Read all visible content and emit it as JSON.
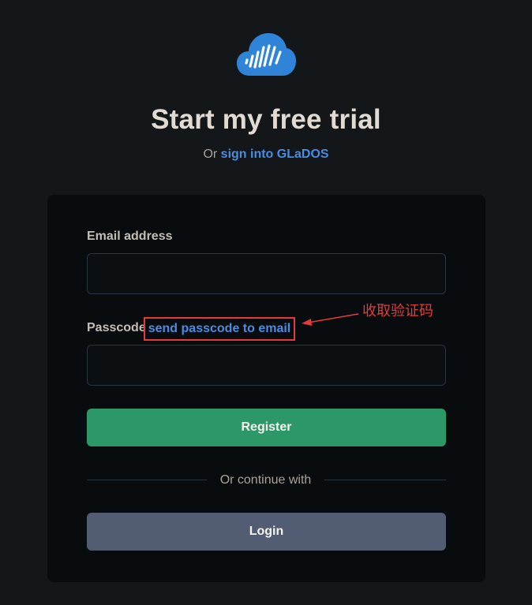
{
  "brand": {
    "logo_icon": "cloud-waveform-icon",
    "logo_color": "#2f84d8"
  },
  "header": {
    "title": "Start my free trial",
    "subtitle_prefix": "Or",
    "signin_link": "sign into GLaDOS"
  },
  "form": {
    "email_label": "Email address",
    "email_value": "",
    "passcode_label": "Passcode",
    "send_passcode_link": "send passcode to email",
    "passcode_value": "",
    "register_label": "Register",
    "divider_text": "Or continue with",
    "login_label": "Login"
  },
  "annotation": {
    "text": "收取验证码",
    "color": "#e43a3a"
  },
  "colors": {
    "background": "#131719",
    "card": "#090c0e",
    "link": "#4a8ce0",
    "register": "#2c9767",
    "login": "#525c72"
  }
}
